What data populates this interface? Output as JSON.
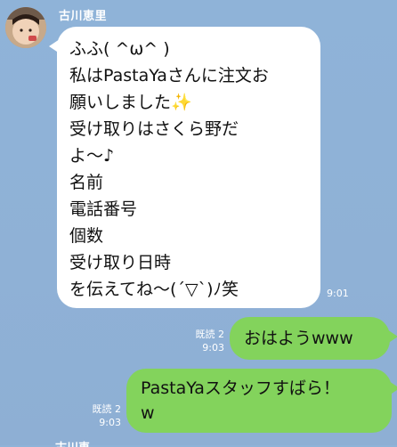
{
  "sender": {
    "name": "古川恵里"
  },
  "incoming": {
    "lines": [
      "ふふ( ^ω^ )",
      "私はPastaYaさんに注文お",
      "願いしました✨",
      "受け取りはさくら野だ",
      "よ〜♪",
      "名前",
      "電話番号",
      "個数",
      "受け取り日時",
      "を伝えてね〜(´▽`)ﾉ笑"
    ],
    "time": "9:01"
  },
  "outgoing": [
    {
      "read": "既読 2",
      "time": "9:03",
      "text": "おはようwww"
    },
    {
      "read": "既読 2",
      "time": "9:03",
      "lines": [
        "PastaYaスタッフすばら！",
        "w"
      ]
    }
  ],
  "next_sender_partial": "古川恵里",
  "colors": {
    "background": "#8fb3d8",
    "outgoing_bubble": "#83d35c",
    "incoming_bubble": "#ffffff"
  }
}
